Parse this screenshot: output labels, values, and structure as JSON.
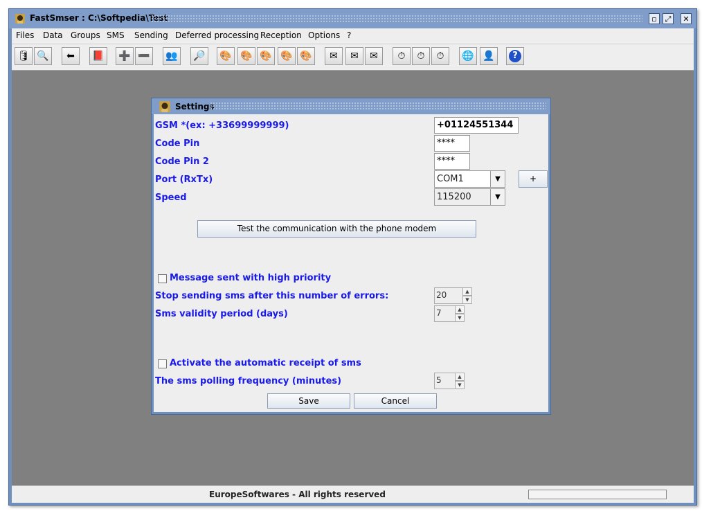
{
  "window": {
    "title": "FastSmser : C:\\Softpedia\\Test",
    "controls": [
      "minimize-icon",
      "maximize-icon",
      "close-icon"
    ]
  },
  "menubar": [
    "Files",
    "Data",
    "Groups",
    "SMS",
    "Sending",
    "Deferred processing",
    "Reception",
    "Options",
    "?"
  ],
  "toolbar": {
    "icons": [
      "database-icon",
      "database-search-icon",
      "back-arrow-icon",
      "book-icon",
      "add-record-icon",
      "remove-record-icon",
      "users-icon",
      "magnifier-icon",
      "palette-icon-1",
      "palette-icon-2",
      "palette-icon-3",
      "palette-icon-4",
      "palette-icon-5",
      "mail-add-icon",
      "mail-icon",
      "mail-remove-icon",
      "clock-add-icon",
      "clock-remove-icon",
      "clock-icon",
      "globe-icon",
      "person-icon",
      "help-icon"
    ]
  },
  "dialog": {
    "title": "Settings",
    "gsm_label": "GSM  *(ex: +33699999999)",
    "gsm_value": "+01124551344",
    "code_pin_label": "Code Pin",
    "code_pin_value": "****",
    "code_pin2_label": "Code Pin 2",
    "code_pin2_value": "****",
    "port_label": "Port (RxTx)",
    "port_value": "COM1",
    "plus_button": "+",
    "speed_label": "Speed",
    "speed_value": "115200",
    "test_button": "Test the communication with the phone modem",
    "priority_label": "Message sent with high priority",
    "stop_label": "Stop sending sms after this number of errors:",
    "stop_value": "20",
    "validity_label": "Sms validity period (days)",
    "validity_value": "7",
    "receipt_label": "Activate the automatic receipt of sms",
    "polling_label": "The sms polling frequency (minutes)",
    "polling_value": "5",
    "save_button": "Save",
    "cancel_button": "Cancel"
  },
  "statusbar": {
    "text": "EuropeSoftwares - All rights reserved"
  }
}
